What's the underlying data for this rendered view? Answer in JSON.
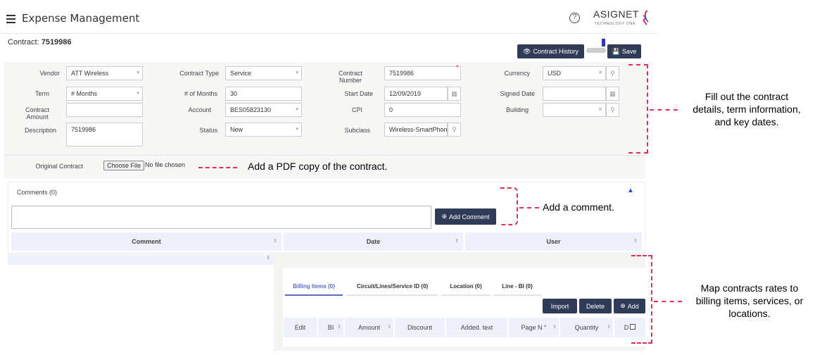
{
  "header": {
    "title": "Expense Management",
    "help_icon": "?",
    "logo": "ASIGNET",
    "logo_sub": "TECHNOLOGY DNA"
  },
  "contract": {
    "label": "Contract:",
    "number": "7519986"
  },
  "actions": {
    "history": "Contract History",
    "save": "Save"
  },
  "form": {
    "vendor": {
      "label": "Vendor",
      "value": "ATT Wireless"
    },
    "contract_type": {
      "label": "Contract Type",
      "value": "Service"
    },
    "contract_number": {
      "label1": "Contract",
      "label2": "Number",
      "value": "7519986"
    },
    "currency": {
      "label": "Currency",
      "value": "USD"
    },
    "term": {
      "label": "Term",
      "value": "# Months"
    },
    "num_months": {
      "label": "# of Months",
      "value": "30"
    },
    "start_date": {
      "label": "Start Date",
      "value": "12/09/2019"
    },
    "signed_date": {
      "label": "Signed Date",
      "value": ""
    },
    "contract_amount": {
      "label1": "Contract",
      "label2": "Amount",
      "value": ""
    },
    "account": {
      "label": "Account",
      "value": "BES05823130"
    },
    "cpi": {
      "label": "CPI",
      "value": "0"
    },
    "building": {
      "label": "Building",
      "value": ""
    },
    "description": {
      "label": "Description",
      "value": "7519986"
    },
    "status": {
      "label": "Status",
      "value": "New"
    },
    "subclass": {
      "label": "Subclass",
      "value": "Wireless-SmartPhon"
    }
  },
  "original_contract": {
    "label": "Original Contract",
    "button": "Choose File",
    "status": "No file chosen"
  },
  "comments": {
    "title": "Comments (0)",
    "add_button": "Add Comment",
    "columns": [
      "Comment",
      "Date",
      "User"
    ]
  },
  "billing": {
    "tabs": [
      "Billing Items (0)",
      "Circuit/Lines/Service ID (0)",
      "Location (0)",
      "Line - BI (0)"
    ],
    "buttons": {
      "import": "Import",
      "delete": "Delete",
      "add": "Add"
    },
    "columns": [
      "Edit",
      "BI",
      "Amount",
      "Discount",
      "Added. text",
      "Page N °",
      "Quantity",
      "D"
    ]
  },
  "annotations": {
    "contract_details": [
      "Fill out the contract",
      "details, term information,",
      "and key dates."
    ],
    "pdf": "Add a PDF copy of the contract.",
    "comment": "Add a comment.",
    "map": [
      "Map contracts rates to",
      "billing items, services, or",
      "locations."
    ]
  },
  "colors": {
    "accent": "#2f3b57",
    "annotation": "#e0305a",
    "tab_active": "#5a6bc4"
  }
}
